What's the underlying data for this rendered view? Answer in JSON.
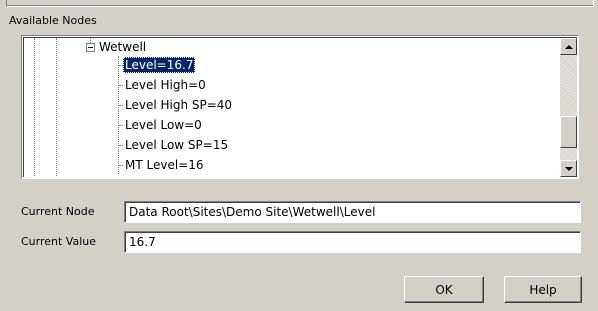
{
  "panel": {
    "label": "Available Nodes"
  },
  "tree": {
    "root": "Wetwell",
    "items": [
      {
        "label": "Level=16.7",
        "selected": true
      },
      {
        "label": "Level High=0",
        "selected": false
      },
      {
        "label": "Level High SP=40",
        "selected": false
      },
      {
        "label": "Level Low=0",
        "selected": false
      },
      {
        "label": "Level Low SP=15",
        "selected": false
      },
      {
        "label": "MT Level=16",
        "selected": false
      }
    ]
  },
  "current_node": {
    "label": "Current Node",
    "value": "Data Root\\Sites\\Demo Site\\Wetwell\\Level"
  },
  "current_value": {
    "label": "Current Value",
    "value": "16.7"
  },
  "buttons": {
    "ok": "OK",
    "help": "Help"
  },
  "colors": {
    "selection": "#0a246a",
    "face": "#d4d0c8"
  }
}
